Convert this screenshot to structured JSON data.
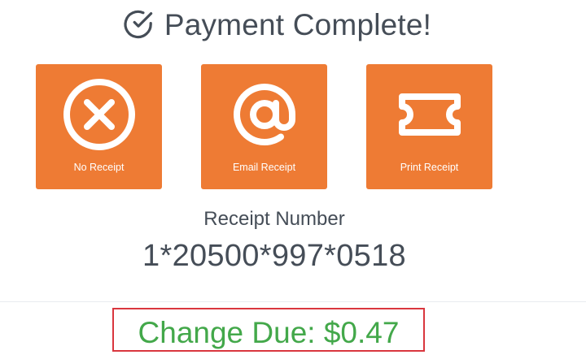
{
  "header": {
    "title": "Payment Complete!",
    "icon": "check-circle-icon"
  },
  "options": [
    {
      "label": "No Receipt",
      "icon": "close-circle-icon"
    },
    {
      "label": "Email Receipt",
      "icon": "at-sign-icon"
    },
    {
      "label": "Print Receipt",
      "icon": "ticket-icon"
    }
  ],
  "receipt": {
    "label": "Receipt Number",
    "number": "1*20500*997*0518"
  },
  "change_due": {
    "text": "Change Due: $0.47"
  },
  "colors": {
    "accent_orange": "#ee7b34",
    "text_dark": "#454d57",
    "success_green": "#43a84a",
    "highlight_red": "#d9363e",
    "icon_white": "#ffffff"
  }
}
